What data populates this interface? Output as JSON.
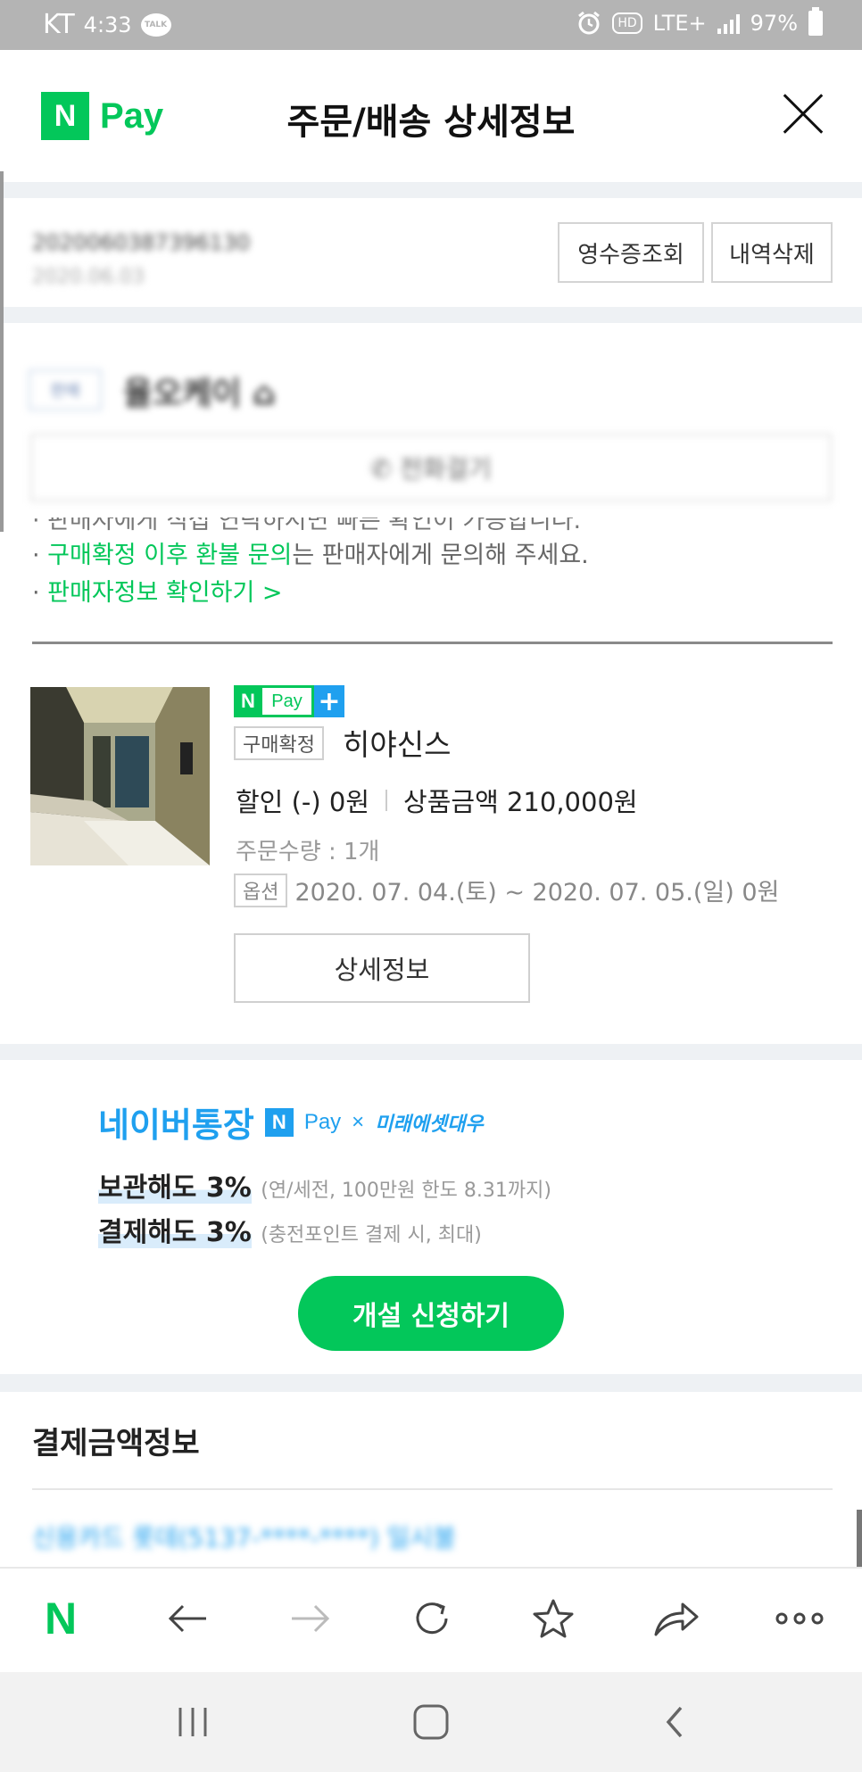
{
  "status_bar": {
    "carrier": "KT",
    "time": "4:33",
    "talk_label": "TALK",
    "hd_label": "HD",
    "network": "LTE+",
    "battery": "97%"
  },
  "header": {
    "logo_n": "N",
    "logo_pay": "Pay",
    "title": "주문/배송 상세정보"
  },
  "order": {
    "order_number": "2020060387396130",
    "order_date": "2020.06.03",
    "receipt_button": "영수증조회",
    "delete_button": "내역삭제"
  },
  "seller": {
    "tag": "판매",
    "name": "율오케이 ⌂",
    "call_button": "✆ 전화걸기"
  },
  "notices": {
    "cut_line": "· 판매자에게 직접 연락하시면 빠른 확인이 가능합니다.",
    "line2_bullet": "· ",
    "line2_green": "구매확정 이후 환불 문의",
    "line2_rest": "는 판매자에게 문의해 주세요.",
    "line3_bullet": "· ",
    "line3_link": "판매자정보 확인하기 >"
  },
  "product": {
    "badge_n": "N",
    "badge_pay": "Pay",
    "badge_plus": "+",
    "status": "구매확정",
    "name": "히야신스",
    "discount": "할인 (-) 0원",
    "price": "상품금액 210,000원",
    "quantity": "주문수량 : 1개",
    "option_label": "옵션",
    "option_value": "2020. 07. 04.(토) ~ 2020. 07. 05.(일) 0원",
    "detail_button": "상세정보"
  },
  "ad": {
    "title": "네이버통장",
    "n": "N",
    "pay": "Pay",
    "times": "×",
    "partner": "미래에셋대우",
    "line1_main": "보관해도 3%",
    "line1_note": "(연/세전, 100만원 한도 8.31까지)",
    "line2_main": "결제해도 3%",
    "line2_note": "(충전포인트 결제 시, 최대)",
    "cta": "개설 신청하기"
  },
  "payment": {
    "title": "결제금액정보",
    "card_line": "신용카드 롯데(5137-****-****) 일시불"
  },
  "toolbar": {
    "home_n": "N",
    "icons": [
      "naver-home-icon",
      "back-arrow-icon",
      "forward-arrow-icon",
      "refresh-icon",
      "star-icon",
      "share-icon",
      "more-icon"
    ]
  },
  "navbar": {
    "icons": [
      "recent-apps-icon",
      "home-icon",
      "back-icon"
    ]
  },
  "colors": {
    "naver_green": "#03c75a",
    "accent_blue": "#1fa0ef",
    "status_bar_gray": "#b4b4b4"
  }
}
